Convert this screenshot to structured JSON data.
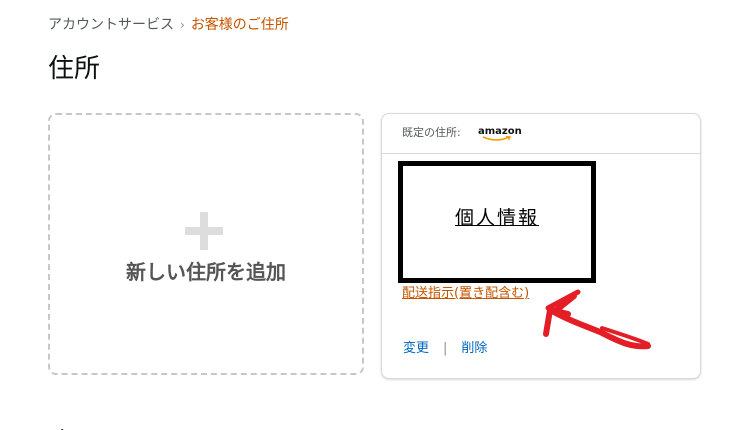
{
  "breadcrumb": {
    "parent": "アカウントサービス",
    "separator": "›",
    "current": "お客様のご住所"
  },
  "page": {
    "title": "住所"
  },
  "add_card": {
    "label": "新しい住所を追加"
  },
  "address_card": {
    "default_label": "既定の住所:",
    "logo_text": "amazon",
    "redacted_text": "個人情報",
    "delivery_instructions_link": "配送指示(置き配含む)",
    "edit_label": "変更",
    "action_separator": "|",
    "delete_label": "削除"
  },
  "colors": {
    "breadcrumb_current": "#c45500",
    "link_blue": "#0066c0",
    "annotation_red": "#e41e26"
  },
  "icons": [
    "plus-icon",
    "amazon-logo",
    "red-arrow-annotation"
  ]
}
